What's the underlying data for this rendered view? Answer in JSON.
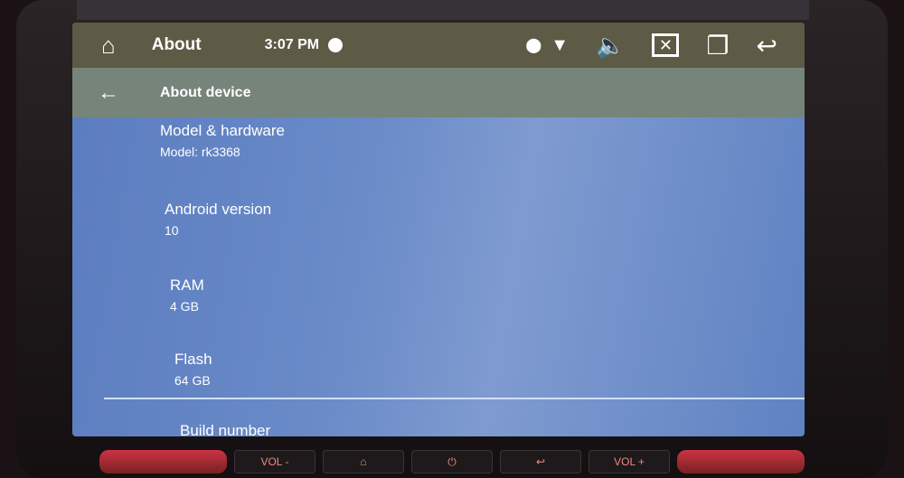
{
  "statusbar": {
    "title": "About",
    "time": "3:07 PM",
    "icons": [
      "home-icon",
      "location-icon",
      "wifi-icon",
      "volume-icon",
      "close-app-icon",
      "recent-apps-icon",
      "back-icon"
    ]
  },
  "toolbar": {
    "title": "About device",
    "back_icon": "arrow-left-icon"
  },
  "items": [
    {
      "label": "Model & hardware",
      "value": "Model: rk3368"
    },
    {
      "label": "Android version",
      "value": "10"
    },
    {
      "label": "RAM",
      "value": "4 GB"
    },
    {
      "label": "Flash",
      "value": "64 GB"
    },
    {
      "label": "Build number",
      "value": ""
    }
  ],
  "hardware_buttons": {
    "vol_down": "VOL -",
    "home": "⌂",
    "power": "⏻",
    "back": "↩",
    "vol_up": "VOL +"
  },
  "colors": {
    "content_bg": "#6a8bc8",
    "statusbar_bg": "#5d5a45",
    "toolbar_bg": "#77847a"
  }
}
